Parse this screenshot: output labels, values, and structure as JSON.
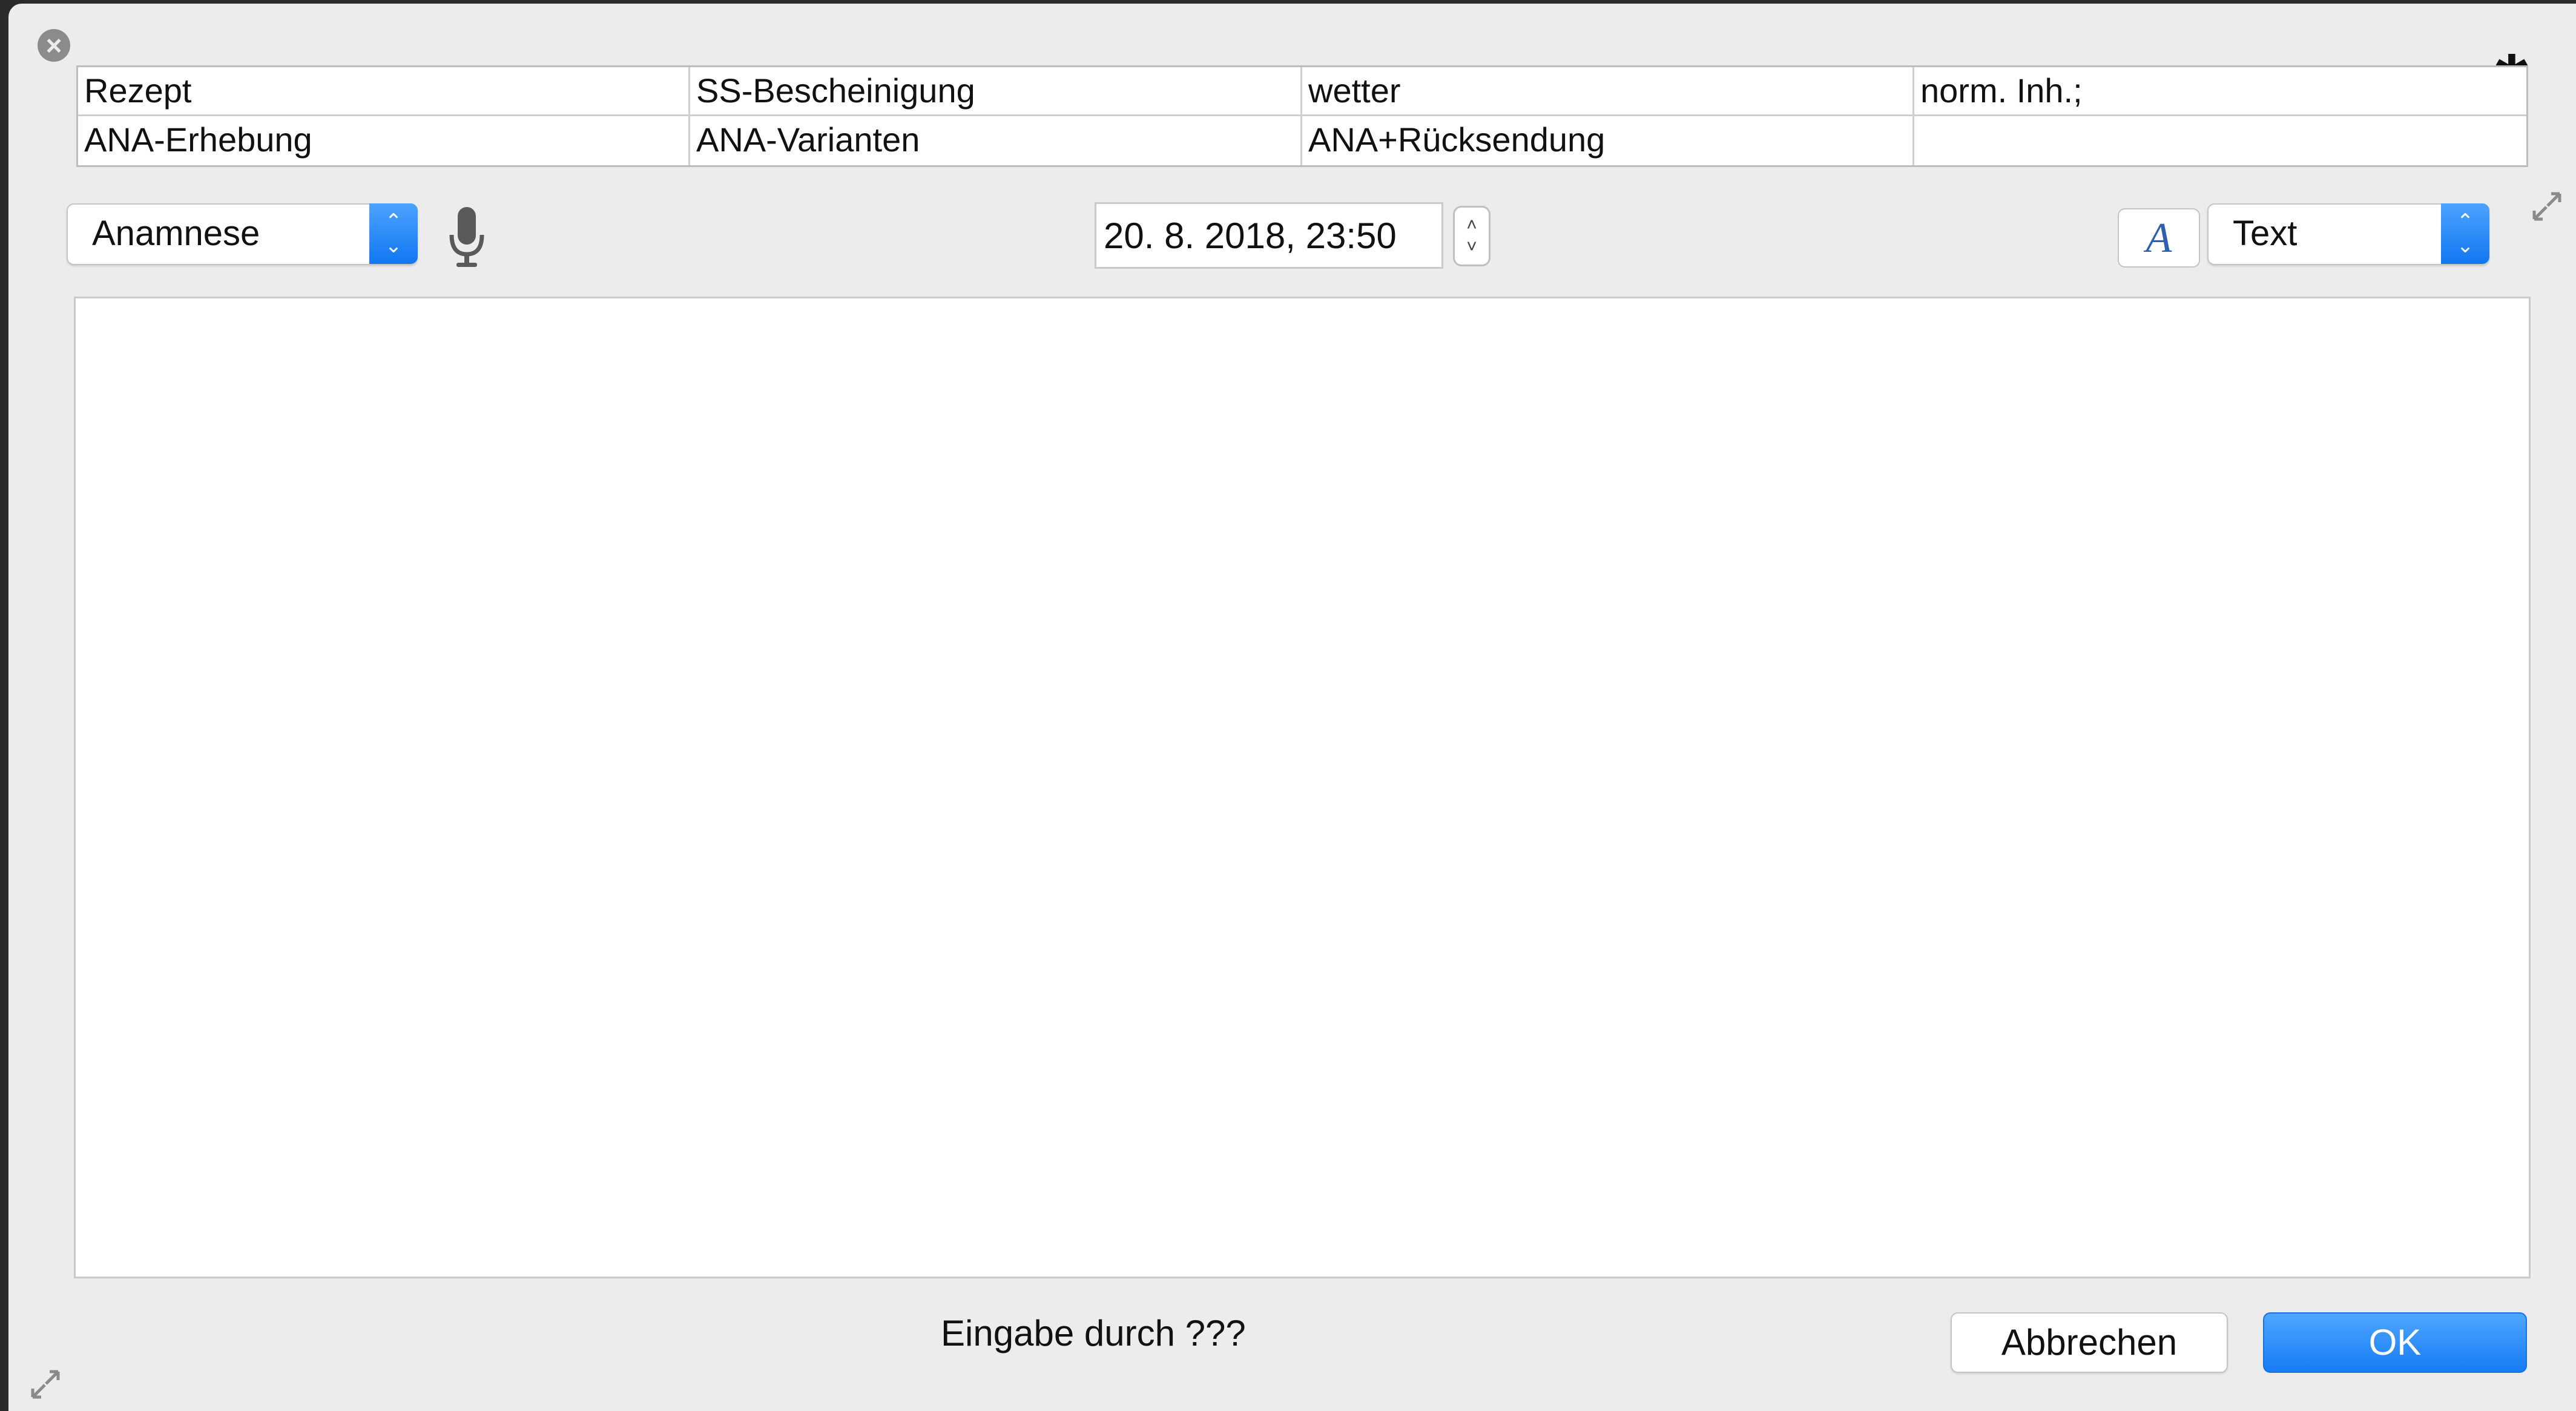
{
  "shortcuts": {
    "rows": [
      [
        "Rezept",
        "SS-Bescheinigung",
        "wetter",
        "norm. Inh.;"
      ],
      [
        "ANA-Erhebung",
        "ANA-Varianten",
        "ANA+Rücksendung",
        ""
      ]
    ]
  },
  "toolbar": {
    "type_select": "Anamnese",
    "datetime": "20.  8. 2018, 23:50",
    "format_select": "Text",
    "font_button": "A"
  },
  "footer": {
    "status": "Eingabe durch ???",
    "cancel_label": "Abbrechen",
    "ok_label": "OK"
  },
  "colors": {
    "accent": "#1577f2",
    "window_bg": "#ececec"
  },
  "icons": {
    "close": "close-icon",
    "gear": "gear-icon",
    "mic": "microphone-icon",
    "expand": "expand-icon"
  }
}
